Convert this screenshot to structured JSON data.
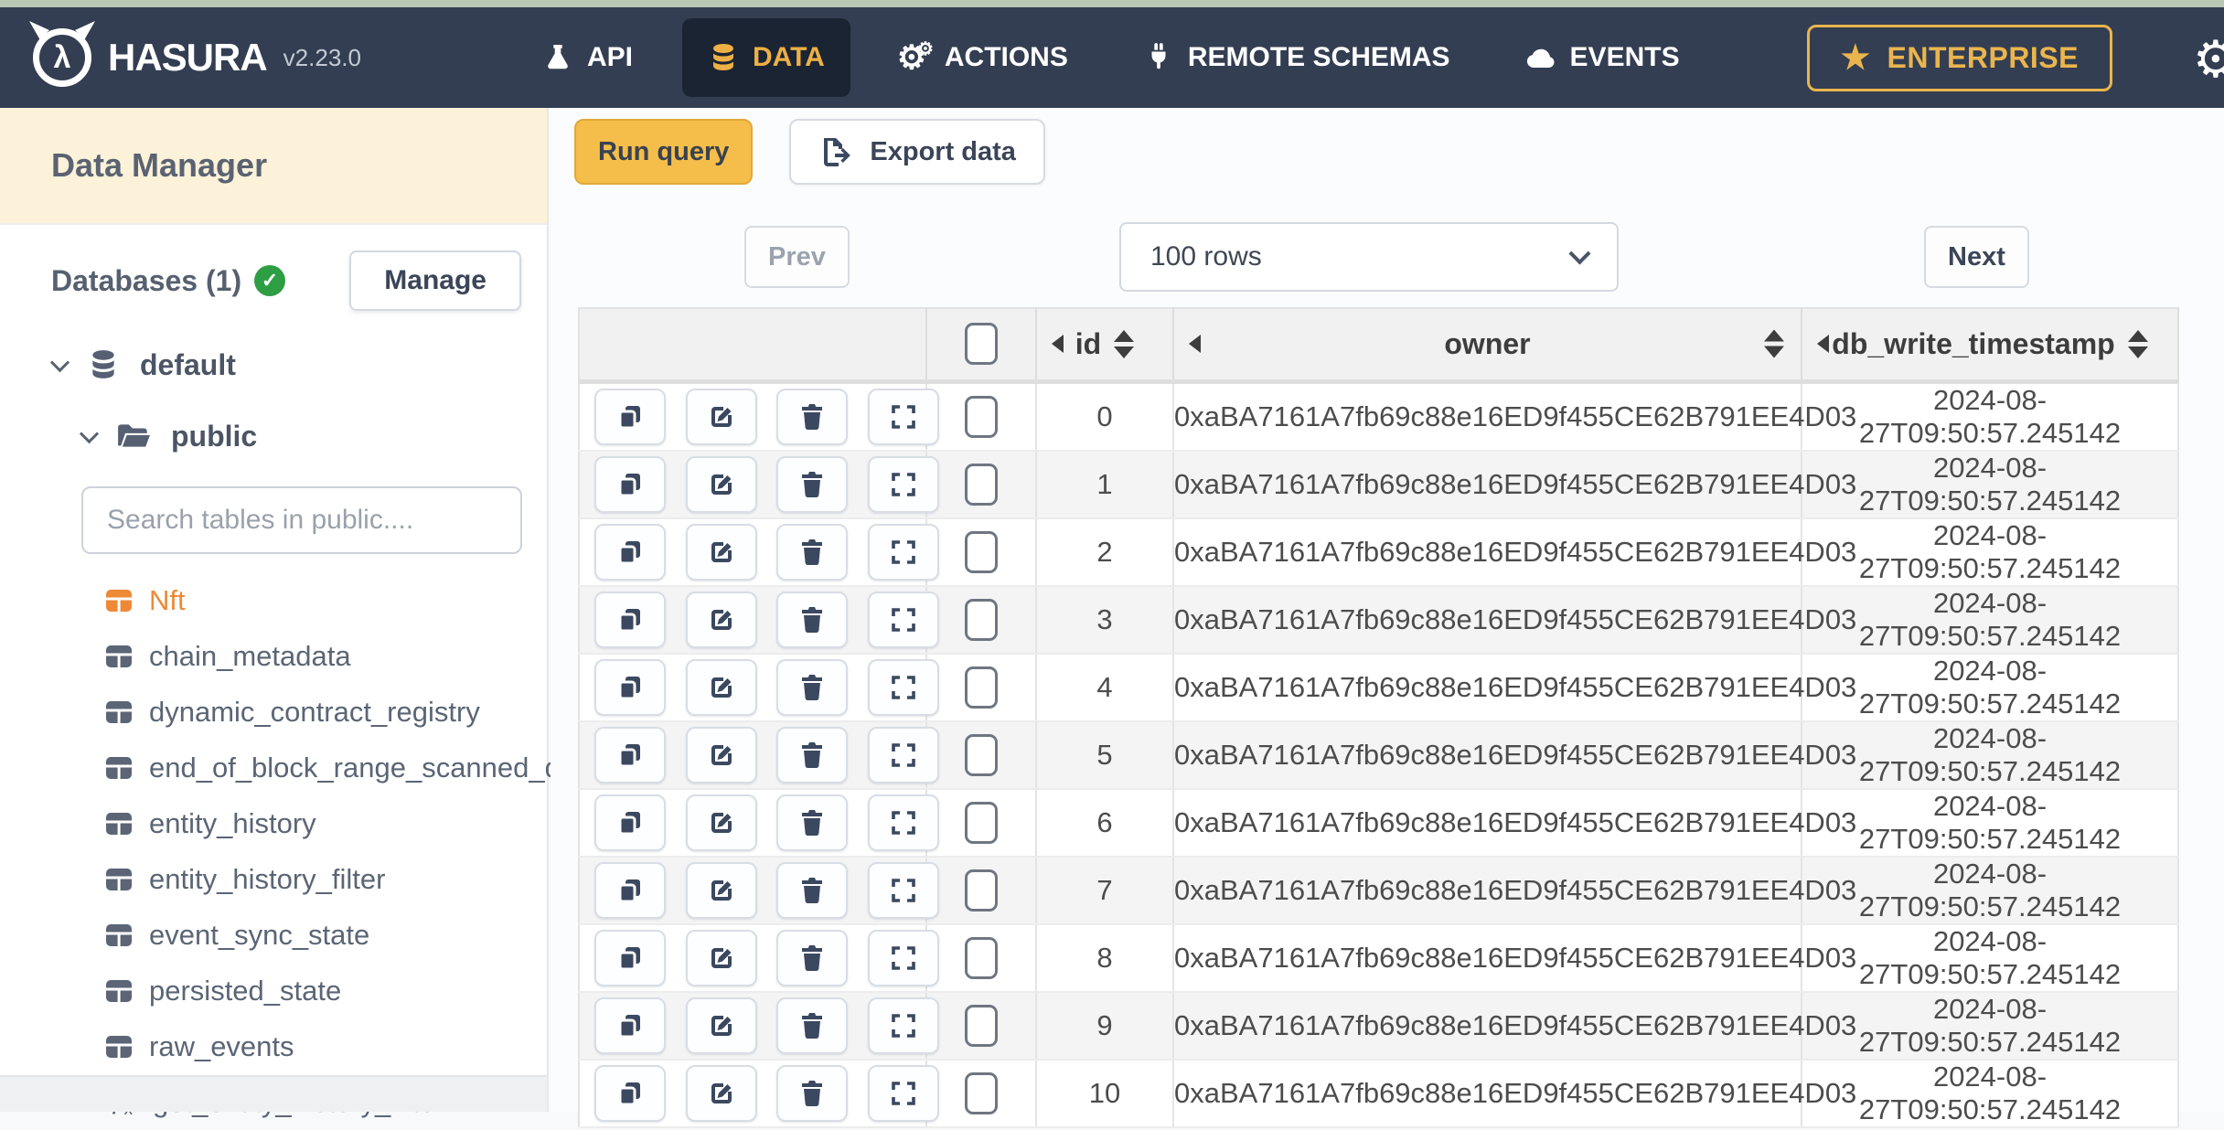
{
  "topbar": {
    "brand": "HASURA",
    "version": "v2.23.0",
    "nav": [
      {
        "label": "API",
        "icon": "flask-icon",
        "active": false
      },
      {
        "label": "DATA",
        "icon": "database-icon",
        "active": true
      },
      {
        "label": "ACTIONS",
        "icon": "gears-icon",
        "active": false
      },
      {
        "label": "REMOTE SCHEMAS",
        "icon": "plug-icon",
        "active": false
      },
      {
        "label": "EVENTS",
        "icon": "cloud-icon",
        "active": false
      }
    ],
    "enterprise_label": "ENTERPRISE",
    "settings_icon": "gear-icon"
  },
  "sidebar": {
    "title": "Data Manager",
    "databases_label": "Databases (1)",
    "databases_status_icon": "check-circle-icon",
    "manage_label": "Manage",
    "database_name": "default",
    "schema_name": "public",
    "search_placeholder": "Search tables in public....",
    "tables": [
      {
        "name": "Nft",
        "type": "table",
        "selected": true
      },
      {
        "name": "chain_metadata",
        "type": "table",
        "selected": false
      },
      {
        "name": "dynamic_contract_registry",
        "type": "table",
        "selected": false
      },
      {
        "name": "end_of_block_range_scanned_data",
        "type": "table",
        "selected": false
      },
      {
        "name": "entity_history",
        "type": "table",
        "selected": false
      },
      {
        "name": "entity_history_filter",
        "type": "table",
        "selected": false
      },
      {
        "name": "event_sync_state",
        "type": "table",
        "selected": false
      },
      {
        "name": "persisted_state",
        "type": "table",
        "selected": false
      },
      {
        "name": "raw_events",
        "type": "table",
        "selected": false
      },
      {
        "name": "get_entity_history_filter",
        "type": "function",
        "selected": false
      }
    ]
  },
  "toolbar": {
    "run_query_label": "Run query",
    "export_data_label": "Export data",
    "export_icon": "file-export-icon"
  },
  "pagination": {
    "prev_label": "Prev",
    "rows_value": "100 rows",
    "next_label": "Next"
  },
  "grid": {
    "columns": {
      "id": "id",
      "owner": "owner",
      "timestamp": "db_write_timestamp"
    },
    "row_action_icons": [
      "clone-icon",
      "edit-icon",
      "trash-icon",
      "expand-icon"
    ],
    "rows": [
      {
        "id": "0",
        "owner": "0xaBA7161A7fb69c88e16ED9f455CE62B791EE4D03",
        "db_write_timestamp": "2024-08-27T09:50:57.245142"
      },
      {
        "id": "1",
        "owner": "0xaBA7161A7fb69c88e16ED9f455CE62B791EE4D03",
        "db_write_timestamp": "2024-08-27T09:50:57.245142"
      },
      {
        "id": "2",
        "owner": "0xaBA7161A7fb69c88e16ED9f455CE62B791EE4D03",
        "db_write_timestamp": "2024-08-27T09:50:57.245142"
      },
      {
        "id": "3",
        "owner": "0xaBA7161A7fb69c88e16ED9f455CE62B791EE4D03",
        "db_write_timestamp": "2024-08-27T09:50:57.245142"
      },
      {
        "id": "4",
        "owner": "0xaBA7161A7fb69c88e16ED9f455CE62B791EE4D03",
        "db_write_timestamp": "2024-08-27T09:50:57.245142"
      },
      {
        "id": "5",
        "owner": "0xaBA7161A7fb69c88e16ED9f455CE62B791EE4D03",
        "db_write_timestamp": "2024-08-27T09:50:57.245142"
      },
      {
        "id": "6",
        "owner": "0xaBA7161A7fb69c88e16ED9f455CE62B791EE4D03",
        "db_write_timestamp": "2024-08-27T09:50:57.245142"
      },
      {
        "id": "7",
        "owner": "0xaBA7161A7fb69c88e16ED9f455CE62B791EE4D03",
        "db_write_timestamp": "2024-08-27T09:50:57.245142"
      },
      {
        "id": "8",
        "owner": "0xaBA7161A7fb69c88e16ED9f455CE62B791EE4D03",
        "db_write_timestamp": "2024-08-27T09:50:57.245142"
      },
      {
        "id": "9",
        "owner": "0xaBA7161A7fb69c88e16ED9f455CE62B791EE4D03",
        "db_write_timestamp": "2024-08-27T09:50:57.245142"
      },
      {
        "id": "10",
        "owner": "0xaBA7161A7fb69c88e16ED9f455CE62B791EE4D03",
        "db_write_timestamp": "2024-08-27T09:50:57.245142"
      }
    ]
  },
  "colors": {
    "nav_bg": "#333e52",
    "nav_active_bg": "#1b2433",
    "accent_gold": "#eeb044",
    "top_strip_green": "#b9c8b3",
    "sidebar_title_cream": "#fcf2d9",
    "selected_table_orange": "#ee8937",
    "run_query_yellow": "#f5bd4a",
    "check_green": "#2e9e44"
  }
}
